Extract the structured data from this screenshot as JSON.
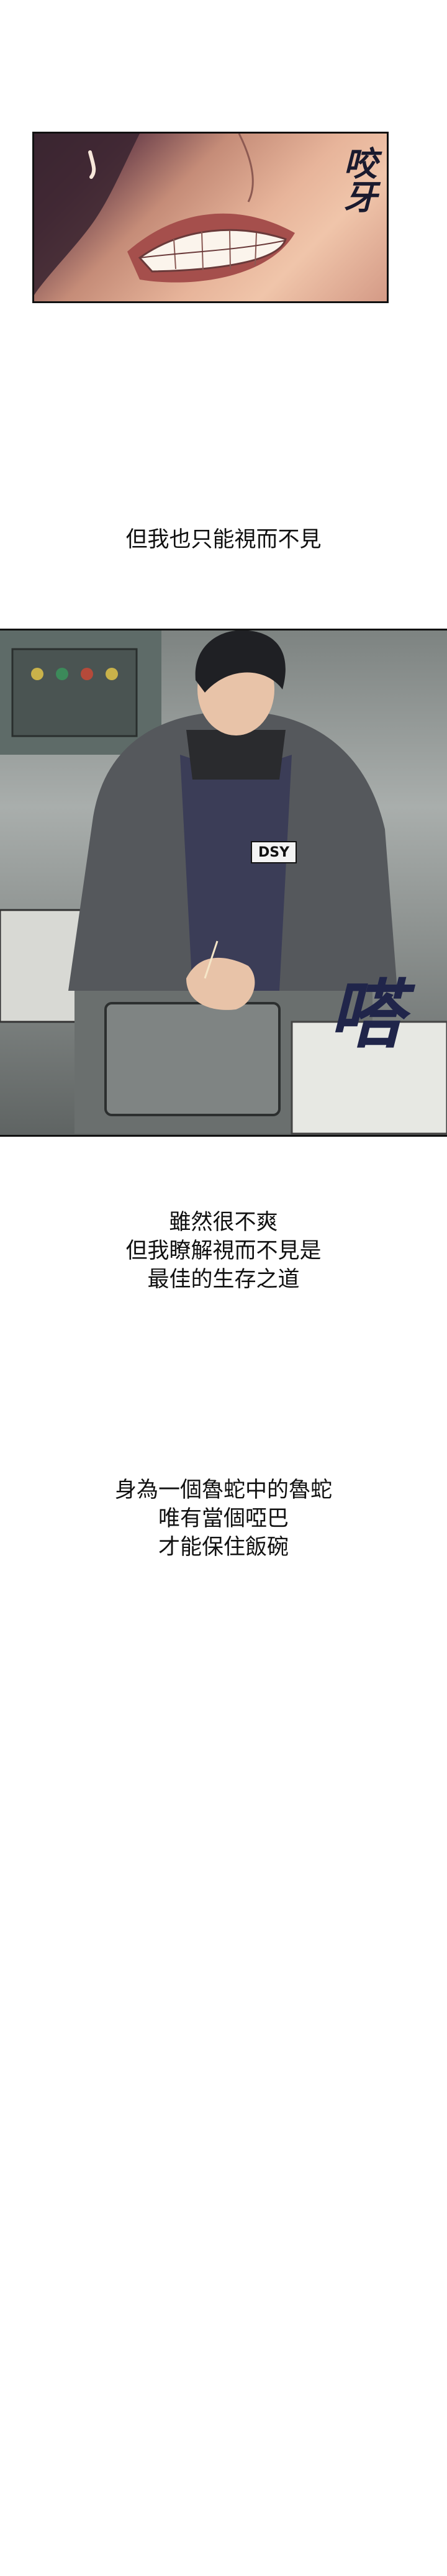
{
  "panel1": {
    "sfx": "咬牙"
  },
  "caption1": {
    "lines": [
      "但我也只能視而不見"
    ]
  },
  "panel2": {
    "badge": "DSY",
    "sfx": "嗒"
  },
  "caption2": {
    "lines": [
      "雖然很不爽",
      "但我瞭解視而不見是",
      "最佳的生存之道"
    ]
  },
  "caption3": {
    "lines": [
      "身為一個魯蛇中的魯蛇",
      "唯有當個啞巴",
      "才能保住飯碗"
    ]
  }
}
